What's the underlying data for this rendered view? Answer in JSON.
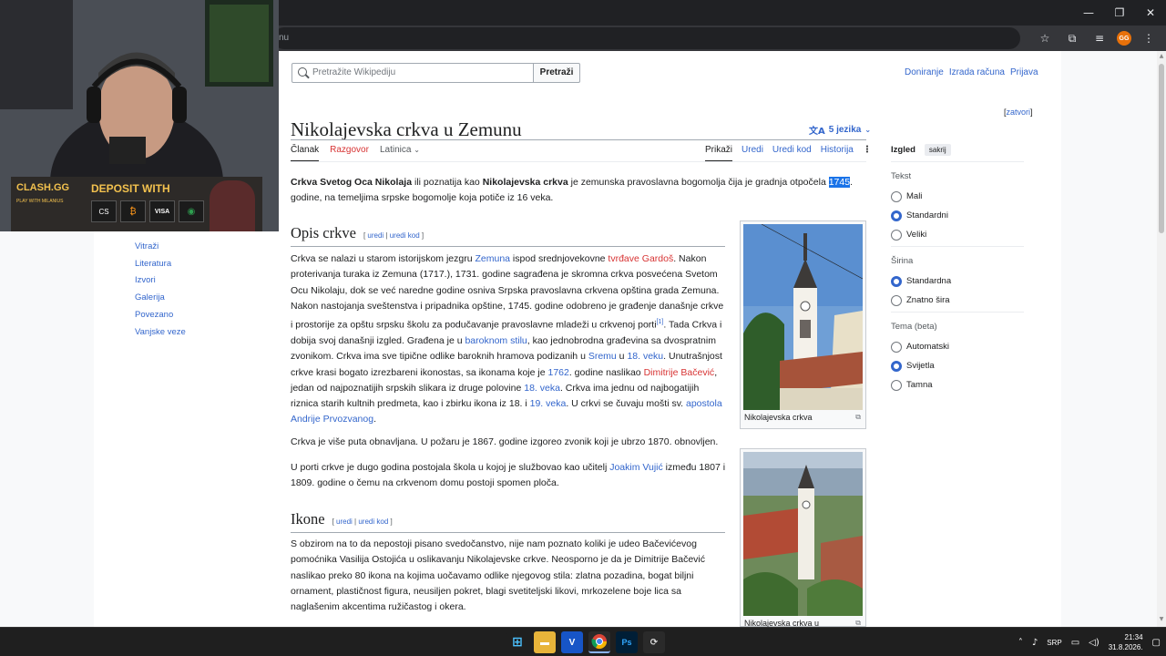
{
  "browser": {
    "url_fragment": "nu",
    "win_minimize": "—",
    "win_restore": "❐",
    "win_close": "✕",
    "star_icon": "☆",
    "extensions_icon": "⧉",
    "menu_icon": "⋮",
    "avatar_text": "GG"
  },
  "wiki": {
    "search_placeholder": "Pretražite Wikipediju",
    "search_button": "Pretraži",
    "user_links": [
      "Doniranje",
      "Izrada računa",
      "Prijava"
    ],
    "zatvori_open": "[",
    "zatvori": "zatvori",
    "zatvori_close": "]",
    "title": "Nikolajevska crkva u Zemunu",
    "languages": "5 jezika",
    "tabs_left": [
      "Članak",
      "Razgovor",
      "Latinica"
    ],
    "tabs_right": [
      "Prikaži",
      "Uredi",
      "Uredi kod",
      "Historija"
    ],
    "lead": {
      "b1": "Crkva Svetog Oca Nikolaja",
      "t1": " ili poznatija kao ",
      "b2": "Nikolajevska crkva",
      "t2": " je zemunska pravoslavna bogomolja čija je gradnja otpočela ",
      "year": "1745",
      "t3": ". godine, na temeljima srpske bogomolje koja potiče iz 16 veka."
    },
    "sections": {
      "opis": "Opis crkve",
      "ikone": "Ikone",
      "edit_uredi": "uredi",
      "edit_sep": " | ",
      "edit_kod": "uredi kod",
      "br_open": "[ ",
      "br_close": " ]"
    },
    "p1": {
      "a": "Crkva se nalazi u starom istorijskom jezgru ",
      "l1": "Zemuna",
      "b": " ispod srednjovekovne ",
      "r1": "tvrđave Gardoš",
      "c": ". Nakon proterivanja turaka iz Zemuna (1717.), 1731. godine sagrađena je skromna crkva posvećena Svetom Ocu Nikolaju, dok se već naredne godine osniva Srpska pravoslavna crkvena opština grada Zemuna. Nakon nastojanja sveštenstva i pripadnika opštine, 1745. godine odobreno je građenje današnje crkve i prostorije za opštu srpsku školu za podučavanje pravoslavne mladeži u crkvenoj porti",
      "sup": "[1]",
      "d": ". Tada Crkva i dobija svoj današnji izgled. Građena je u ",
      "l2": "baroknom stilu",
      "e": ", kao jednobrodna građevina sa dvospratnim zvonikom. Crkva ima sve tipične odlike baroknih hramova podizanih u ",
      "l3": "Sremu",
      "f": " u ",
      "l4": "18. veku",
      "g": ". Unutrašnjost crkve krasi bogato izrezbareni ikonostas, sa ikonama koje je ",
      "l5": "1762",
      "h": ". godine naslikao ",
      "r2": "Dimitrije Bačević",
      "i": ", jedan od najpoznatijih srpskih slikara iz druge polovine ",
      "l6": "18. veka",
      "j": ". Crkva ima jednu od najbogatijih riznica starih kultnih predmeta, kao i zbirku ikona iz 18. i ",
      "l7": "19. veka",
      "k": ". U crkvi se čuvaju mošti sv. ",
      "l8": "apostola Andrije Prvozvanog",
      "m": "."
    },
    "p2": "Crkva je više puta obnavljana. U požaru je 1867. godine izgoreo zvonik koji je ubrzo 1870. obnovljen.",
    "p3": {
      "a": "U porti crkve je dugo godina postojala škola u kojoj je službovao kao učitelj ",
      "l1": "Joakim Vujić",
      "b": " između 1807 i 1809. godine o čemu na crkvenom domu postoji spomen ploča."
    },
    "p4": "S obzirom na to da nepostoji pisano svedočanstvo, nije nam poznato koliki je udeo Bačevićevog pomoćnika Vasilija Ostojića u oslikavanju Nikolajevske crkve. Neosporno je da je Dimitrije Bačević naslikao preko 80 ikona na kojima uočavamo odlike njegovog stila: zlatna pozadina, bogat biljni ornament, plastičnost figura, neusiljen pokret, blagi svetiteljski likovi, mrkozelene boje lica sa naglašenim akcentima ružičastog i okera.",
    "captions": [
      "Nikolajevska crkva",
      "Nikolajevska crkva u"
    ],
    "toc": [
      "Vitraži",
      "Literatura",
      "Izvori",
      "Galerija",
      "Povezano",
      "Vanjske veze"
    ],
    "appearance": {
      "title": "Izgled",
      "hide": "sakrij",
      "text_label": "Tekst",
      "text_options": [
        "Mali",
        "Standardni",
        "Veliki"
      ],
      "text_selected": 1,
      "width_label": "Širina",
      "width_options": [
        "Standardna",
        "Znatno šira"
      ],
      "width_selected": 0,
      "theme_label": "Tema (beta)",
      "theme_options": [
        "Automatski",
        "Svijetla",
        "Tamna"
      ],
      "theme_selected": 1
    }
  },
  "overlay": {
    "brand": "CLASH.GG",
    "deposit": "DEPOSIT WITH",
    "play_with": "PLAY WITH MILANIUS",
    "pay_methods": [
      "CS",
      "₿",
      "VISA",
      "◉"
    ]
  },
  "taskbar": {
    "apps": [
      "⊞",
      "📁",
      "V",
      "◎",
      "Ps",
      "⟳"
    ],
    "lang": "SRP",
    "time": "21:34",
    "date": "31.8.2026."
  },
  "colors": {
    "link": "#3366cc",
    "redlink": "#d73333",
    "accent": "#1a73e8"
  }
}
